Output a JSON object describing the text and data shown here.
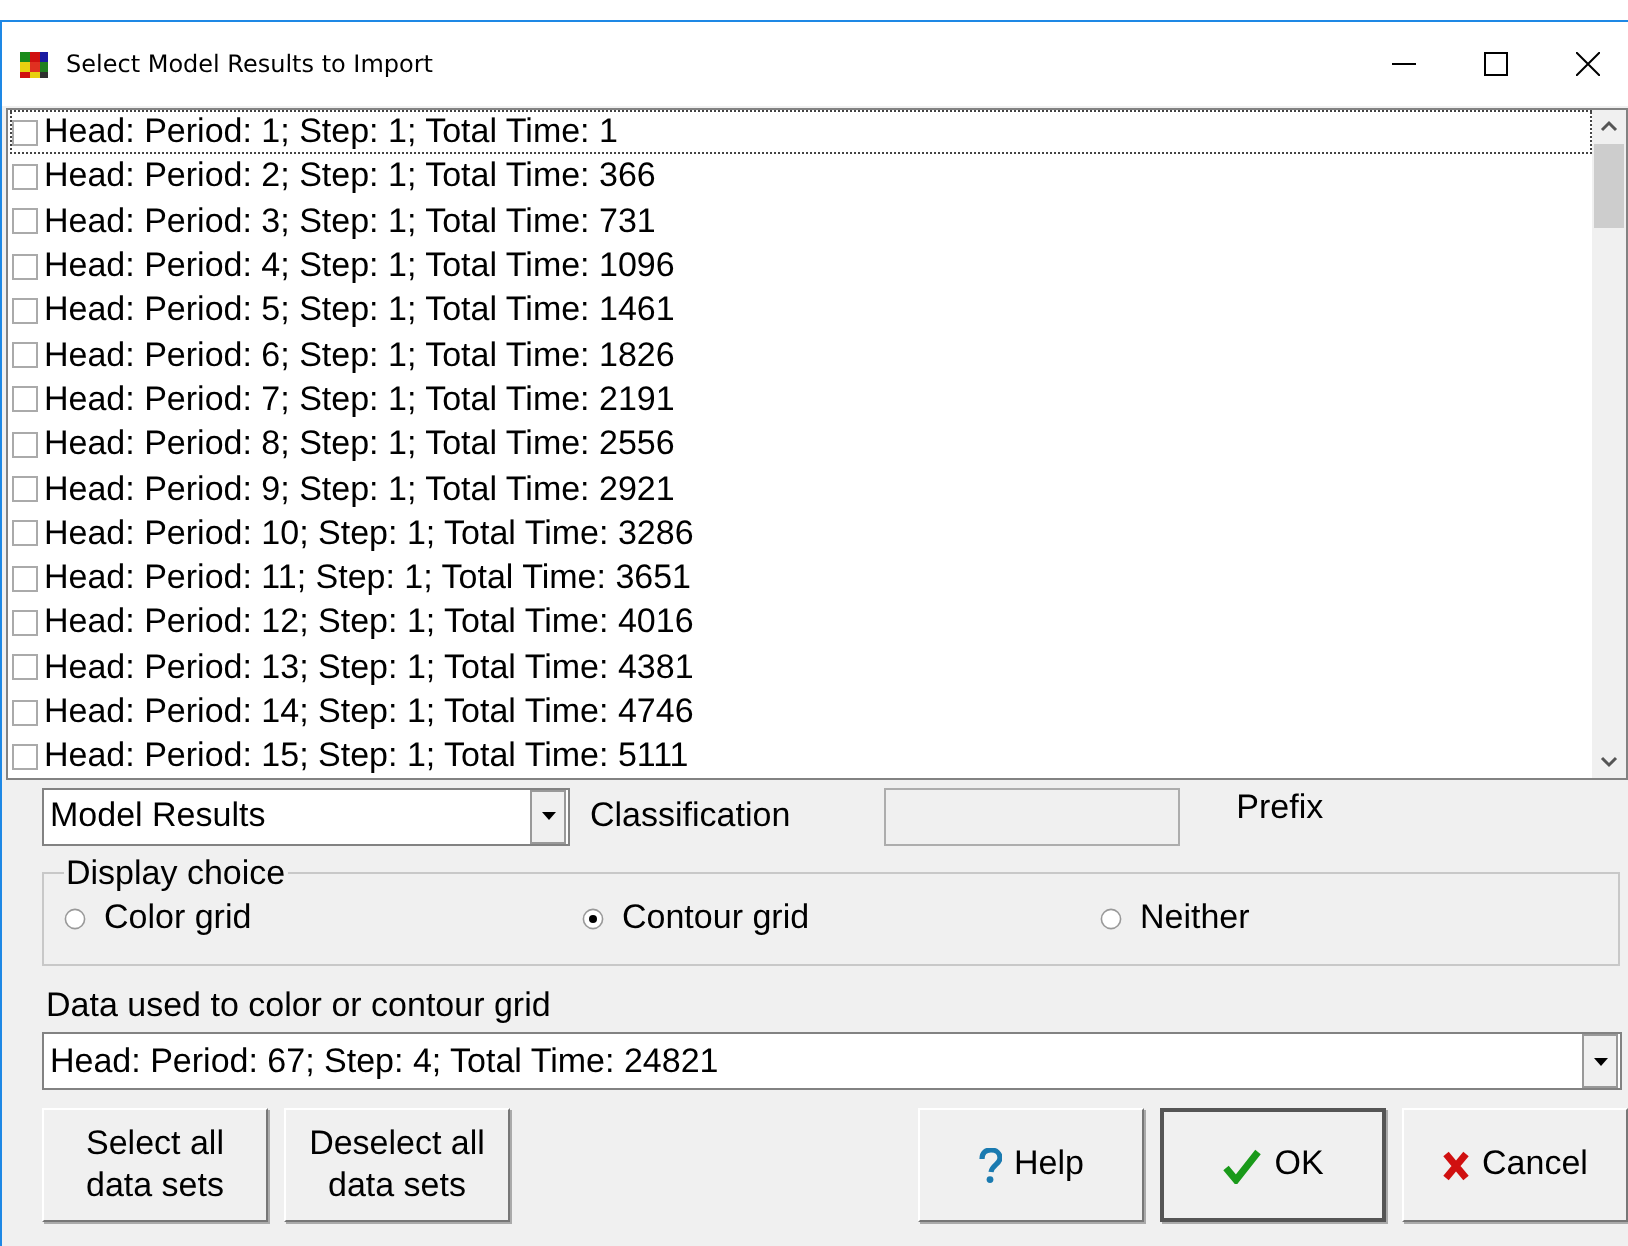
{
  "window": {
    "title": "Select Model Results to Import"
  },
  "data_sets": [
    {
      "label": "Head: Period: 1; Step: 1; Total Time: 1",
      "checked": false,
      "focused": true
    },
    {
      "label": "Head: Period: 2; Step: 1; Total Time: 366",
      "checked": false,
      "focused": false
    },
    {
      "label": "Head: Period: 3; Step: 1; Total Time: 731",
      "checked": false,
      "focused": false
    },
    {
      "label": "Head: Period: 4; Step: 1; Total Time: 1096",
      "checked": false,
      "focused": false
    },
    {
      "label": "Head: Period: 5; Step: 1; Total Time: 1461",
      "checked": false,
      "focused": false
    },
    {
      "label": "Head: Period: 6; Step: 1; Total Time: 1826",
      "checked": false,
      "focused": false
    },
    {
      "label": "Head: Period: 7; Step: 1; Total Time: 2191",
      "checked": false,
      "focused": false
    },
    {
      "label": "Head: Period: 8; Step: 1; Total Time: 2556",
      "checked": false,
      "focused": false
    },
    {
      "label": "Head: Period: 9; Step: 1; Total Time: 2921",
      "checked": false,
      "focused": false
    },
    {
      "label": "Head: Period: 10; Step: 1; Total Time: 3286",
      "checked": false,
      "focused": false
    },
    {
      "label": "Head: Period: 11; Step: 1; Total Time: 3651",
      "checked": false,
      "focused": false
    },
    {
      "label": "Head: Period: 12; Step: 1; Total Time: 4016",
      "checked": false,
      "focused": false
    },
    {
      "label": "Head: Period: 13; Step: 1; Total Time: 4381",
      "checked": false,
      "focused": false
    },
    {
      "label": "Head: Period: 14; Step: 1; Total Time: 4746",
      "checked": false,
      "focused": false
    },
    {
      "label": "Head: Period: 15; Step: 1; Total Time: 5111",
      "checked": false,
      "focused": false
    }
  ],
  "source": {
    "value": "Model Results",
    "classification_label": "Classification",
    "prefix_label": "Prefix"
  },
  "display_choice": {
    "title": "Display choice",
    "options": [
      {
        "label": "Color grid",
        "selected": false
      },
      {
        "label": "Contour grid",
        "selected": true
      },
      {
        "label": "Neither",
        "selected": false
      }
    ]
  },
  "data_used": {
    "label": "Data used to color or contour grid",
    "value": "Head: Period: 67; Step: 4; Total Time: 24821"
  },
  "buttons": [
    {
      "kind": "select_all",
      "label": "Select all data sets"
    },
    {
      "kind": "deselect_all",
      "label": "Deselect all data sets"
    },
    {
      "kind": "help",
      "label": "Help"
    },
    {
      "kind": "ok",
      "label": "OK"
    },
    {
      "kind": "cancel",
      "label": "Cancel"
    }
  ]
}
